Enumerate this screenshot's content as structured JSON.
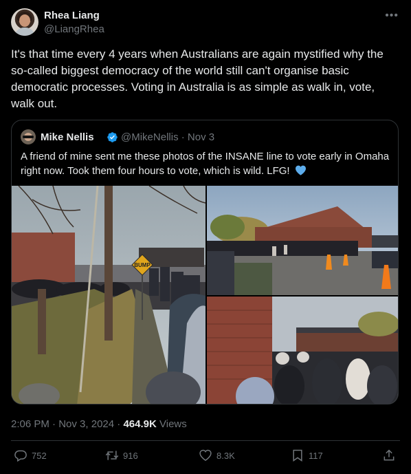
{
  "tweet": {
    "author_name": "Rhea Liang",
    "author_handle": "@LiangRhea",
    "more_icon": "more-horizontal-icon",
    "text": "It's that time every 4 years when Australians are again mystified why the so-called biggest democracy of the world still can't organise basic democratic processes. Voting in Australia is as simple as walk in, vote, walk out.",
    "time": "2:06 PM",
    "date": "Nov 3, 2024",
    "separator": "·",
    "views_count": "464.9K",
    "views_label": "Views"
  },
  "quote": {
    "author_name": "Mike Nellis",
    "author_handle": "@MikeNellis",
    "separator": "·",
    "date": "Nov 3",
    "verified_color": "#1d9bf0",
    "text": "A friend of mine sent me these photos of the INSANE line to vote early in Omaha right now. Took them four hours to vote, which is wild. LFG!",
    "emoji": "blue-heart",
    "sign_text": "BUMP"
  },
  "actions": {
    "replies": "752",
    "reposts": "916",
    "likes": "8.3K",
    "bookmarks": "117"
  },
  "colors": {
    "background": "#000000",
    "text": "#e7e9ea",
    "secondary": "#71767b",
    "border": "#2f3336",
    "accent": "#1d9bf0"
  }
}
